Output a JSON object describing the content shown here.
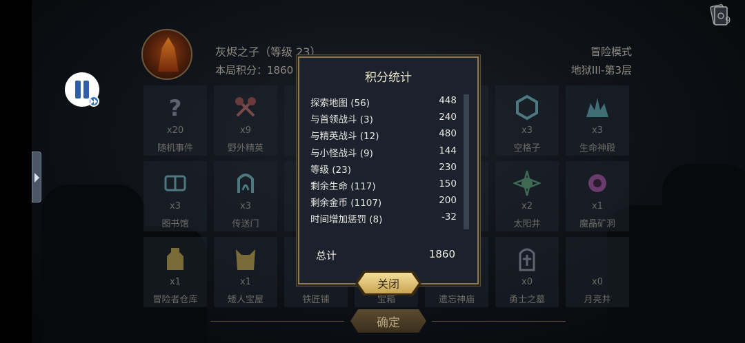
{
  "top_right": {
    "card_count": "9"
  },
  "hero": {
    "name": "灰烬之子（等级 23）",
    "score_text": "本局积分：1860"
  },
  "mode": {
    "label": "冒险模式",
    "floor": "地狱III-第3层"
  },
  "tiles": [
    {
      "count": "x20",
      "label": "随机事件",
      "icon": "question-mark-icon"
    },
    {
      "count": "x9",
      "label": "野外精英",
      "icon": "crossed-axes-icon"
    },
    {
      "count": "x3",
      "label": "空格子",
      "icon": "hexagon-icon"
    },
    {
      "count": "x3",
      "label": "生命神殿",
      "icon": "temple-icon"
    },
    {
      "count": "x3",
      "label": "图书馆",
      "icon": "book-icon"
    },
    {
      "count": "x3",
      "label": "传送门",
      "icon": "portal-icon"
    },
    {
      "count": "x2",
      "label": "太阳井",
      "icon": "sun-well-icon"
    },
    {
      "count": "x1",
      "label": "魔晶矿洞",
      "icon": "crystal-mine-icon"
    },
    {
      "count": "x1",
      "label": "冒险者仓库",
      "icon": "warehouse-icon"
    },
    {
      "count": "x1",
      "label": "矮人宝屋",
      "icon": "dwarf-vault-icon"
    },
    {
      "count": "",
      "label": "铁匠铺",
      "icon": "anvil-icon"
    },
    {
      "count": "",
      "label": "宝箱",
      "icon": "chest-icon"
    },
    {
      "count": "",
      "label": "遗忘神庙",
      "icon": "shrine-icon"
    },
    {
      "count": "x0",
      "label": "勇士之墓",
      "icon": "tomb-icon"
    },
    {
      "count": "x0",
      "label": "月亮井",
      "icon": "moon-well-icon"
    }
  ],
  "confirm_label": "确定",
  "modal": {
    "title": "积分统计",
    "rows": [
      {
        "name": "探索地图 (56)",
        "value": "448"
      },
      {
        "name": "与首领战斗 (3)",
        "value": "240"
      },
      {
        "name": "与精英战斗 (12)",
        "value": "480"
      },
      {
        "name": "与小怪战斗 (9)",
        "value": "144"
      },
      {
        "name": "等级 (23)",
        "value": "230"
      },
      {
        "name": "剩余生命 (117)",
        "value": "150"
      },
      {
        "name": "剩余金币 (1107)",
        "value": "200"
      },
      {
        "name": "时间增加惩罚 (8)",
        "value": "-32"
      }
    ],
    "total_label": "总计",
    "total_value": "1860",
    "close_label": "关闭"
  },
  "colors": {
    "gold": "#c9a553",
    "panel": "#1b222d",
    "border": "#8b7a58"
  }
}
